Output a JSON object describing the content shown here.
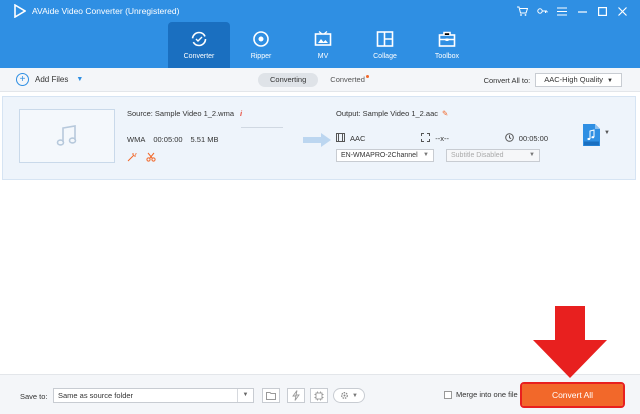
{
  "app": {
    "title": "AVAide Video Converter (Unregistered)"
  },
  "window_controls": [
    "cart-icon",
    "key-icon",
    "menu-icon",
    "minimize-icon",
    "maximize-icon",
    "close-icon"
  ],
  "nav": {
    "items": [
      {
        "label": "Converter",
        "icon": "converter-icon",
        "active": true
      },
      {
        "label": "Ripper",
        "icon": "ripper-icon",
        "active": false
      },
      {
        "label": "MV",
        "icon": "mv-icon",
        "active": false
      },
      {
        "label": "Collage",
        "icon": "collage-icon",
        "active": false
      },
      {
        "label": "Toolbox",
        "icon": "toolbox-icon",
        "active": false
      }
    ]
  },
  "toolbar": {
    "add_files": "Add Files",
    "tabs": [
      {
        "label": "Converting",
        "active": true
      },
      {
        "label": "Converted",
        "active": false
      }
    ],
    "convert_all_to_label": "Convert All to:",
    "convert_all_to_value": "AAC-High Quality"
  },
  "file_item": {
    "source_name": "Source: Sample Video 1_2.wma",
    "info_glyph": "i",
    "format": "WMA",
    "duration": "00:05:00",
    "size": "5.51 MB",
    "output_name": "Output: Sample Video 1_2.aac",
    "output_format": "AAC",
    "output_resolution": "--x--",
    "output_duration": "00:05:00",
    "audio_track": "EN-WMAPRO-2Channel",
    "subtitle": "Subtitle Disabled",
    "format_badge": "AAC"
  },
  "bottom": {
    "save_to_label": "Save to:",
    "save_to_value": "Same as source folder",
    "merge_label": "Merge into one file",
    "convert_all": "Convert All"
  },
  "colors": {
    "header": "#2f8fe3",
    "active_tab": "#1a6fc0",
    "accent": "#f2682a",
    "callout": "#e8201f"
  }
}
